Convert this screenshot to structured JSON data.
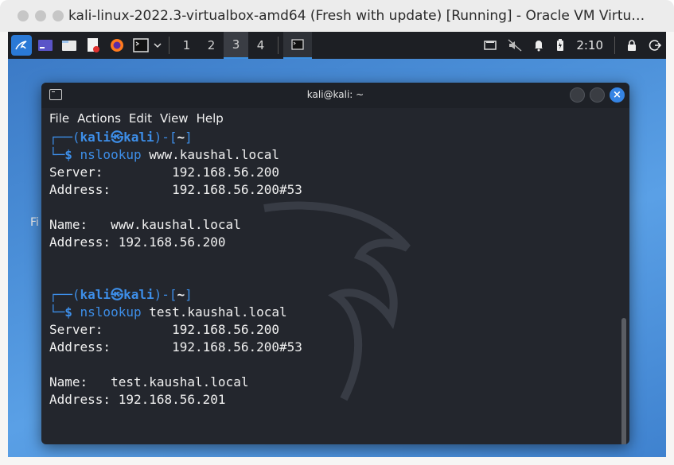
{
  "host": {
    "title": "kali-linux-2022.3-virtualbox-amd64 (Fresh with update) [Running] - Oracle VM Virtu…"
  },
  "panel": {
    "workspaces": [
      "1",
      "2",
      "3",
      "4"
    ],
    "active_workspace": "3",
    "clock": "2:10",
    "accent_color": "#3b8fe0"
  },
  "desktop": {
    "partial_label": "Fi"
  },
  "terminal": {
    "title": "kali@kali: ~",
    "close_symbol": "×",
    "menu": [
      "File",
      "Actions",
      "Edit",
      "View",
      "Help"
    ],
    "sessions": [
      {
        "prompt_top_left": "┌──(",
        "user": "kali㉿kali",
        "prompt_mid": ")-[",
        "path": "~",
        "prompt_end": "]",
        "prompt_bottom": "└─",
        "dollar": "$ ",
        "cmd": "nslookup",
        "arg": " www.kaushal.local",
        "output": [
          "Server:         192.168.56.200",
          "Address:        192.168.56.200#53",
          "",
          "Name:   www.kaushal.local",
          "Address: 192.168.56.200",
          "",
          ""
        ]
      },
      {
        "prompt_top_left": "┌──(",
        "user": "kali㉿kali",
        "prompt_mid": ")-[",
        "path": "~",
        "prompt_end": "]",
        "prompt_bottom": "└─",
        "dollar": "$ ",
        "cmd": "nslookup",
        "arg": " test.kaushal.local",
        "output": [
          "Server:         192.168.56.200",
          "Address:        192.168.56.200#53",
          "",
          "Name:   test.kaushal.local",
          "Address: 192.168.56.201"
        ]
      }
    ]
  }
}
